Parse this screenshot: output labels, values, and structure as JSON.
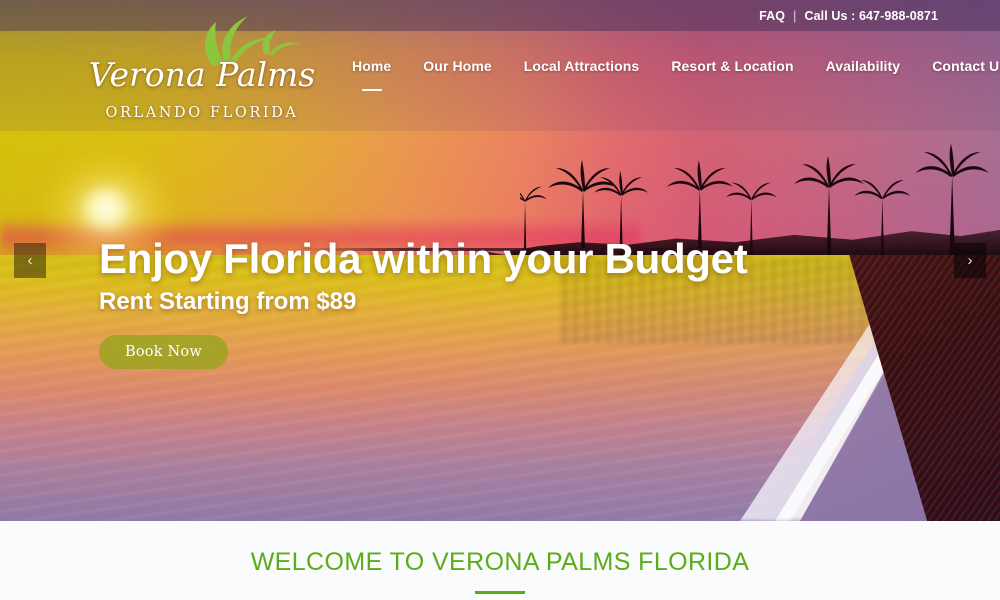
{
  "topbar": {
    "faq_label": "FAQ",
    "separator": "|",
    "call_label": "Call Us : 647-988-0871"
  },
  "logo": {
    "brand": "Verona Palms",
    "subtitle": "ORLANDO  FLORIDA",
    "icon": "palm-fronds-icon"
  },
  "nav": {
    "items": [
      {
        "label": "Home",
        "active": true
      },
      {
        "label": "Our Home",
        "active": false
      },
      {
        "label": "Local Attractions",
        "active": false
      },
      {
        "label": "Resort & Location",
        "active": false
      },
      {
        "label": "Availability",
        "active": false
      },
      {
        "label": "Contact Us",
        "active": false
      }
    ]
  },
  "hero": {
    "headline": "Enjoy Florida within your Budget",
    "subheadline": "Rent Starting from $89",
    "cta_label": "Book Now",
    "prev_icon": "chevron-left-icon",
    "next_icon": "chevron-right-icon",
    "prev_glyph": "‹",
    "next_glyph": "›",
    "image_description": "Tropical sunset beach with palm tree silhouettes"
  },
  "welcome": {
    "heading": "WELCOME TO VERONA PALMS FLORIDA"
  },
  "colors": {
    "accent_green": "#5aad17",
    "button_olive": "#96a51e",
    "topbar_purple": "#3e2c56",
    "text_white": "#ffffff",
    "section_bg": "#fafbfd"
  }
}
